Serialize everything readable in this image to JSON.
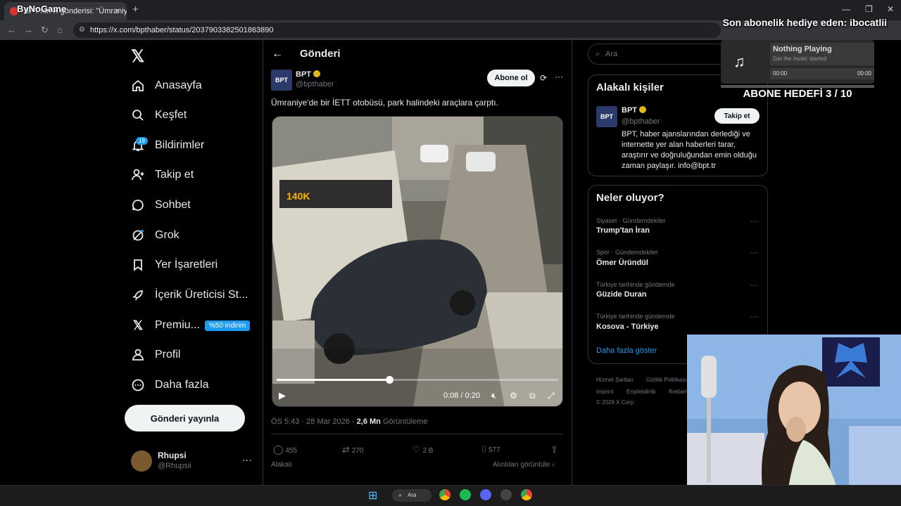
{
  "browser": {
    "tab_title": "BPT'nin X gönderisi: \"Ümraniye'de bir",
    "tab_close": "×",
    "new_tab": "+",
    "url": "https://x.com/bpthaber/status/2037903382501863890"
  },
  "overlays": {
    "logo_text": "ByNoGame",
    "subscriber_gift": "Son abonelik hediye eden: ibocatlii",
    "music_title": "Nothing Playing",
    "music_subtitle": "Get the music started",
    "music_time_start": "00:00",
    "music_time_end": "00:00",
    "abone_goal": "ABONE HEDEFİ 3 / 10"
  },
  "nav": {
    "items": [
      {
        "label": "Anasayfa",
        "icon": "home-icon"
      },
      {
        "label": "Keşfet",
        "icon": "search-icon"
      },
      {
        "label": "Bildirimler",
        "icon": "bell-icon"
      },
      {
        "label": "Takip et",
        "icon": "follow-icon"
      },
      {
        "label": "Sohbet",
        "icon": "chat-icon"
      },
      {
        "label": "Grok",
        "icon": "grok-icon"
      },
      {
        "label": "Yer İşaretleri",
        "icon": "bookmark-icon"
      },
      {
        "label": "İçerik Üreticisi St...",
        "icon": "rocket-icon"
      },
      {
        "label": "Premiu...",
        "icon": "x-icon"
      },
      {
        "label": "Profil",
        "icon": "profile-icon"
      },
      {
        "label": "Daha fazla",
        "icon": "more-icon"
      }
    ],
    "notification_count": "19",
    "premium_badge": "%50 indirim",
    "post_button": "Gönderi yayınla"
  },
  "account": {
    "name": "Rhupsi",
    "handle": "@Rhupsii",
    "more": "···"
  },
  "post": {
    "header": "Gönderi",
    "author_avatar_text": "BPT",
    "author_name": "BPT",
    "author_handle": "@bpthaber",
    "follow_label": "Abone ol",
    "more": "···",
    "text": "Ümraniye'de bir İETT otobüsü, park halindeki araçlara çarptı.",
    "video_time": "0:08 / 0:20",
    "video_progress": 0.4,
    "timestamp": "ÖS 5:43 · 28 Mar 2026 · ",
    "views_count": "2,6 Mn",
    "views_label": " Görüntüleme",
    "stats": {
      "replies": "455",
      "reposts": "270",
      "likes": "2 B",
      "bookmarks": "577"
    },
    "related": "Alakalı",
    "quotes": "Alıntıları görüntüle ›"
  },
  "right": {
    "search_placeholder": "Ara",
    "people_title": "Alakalı kişiler",
    "person": {
      "avatar_text": "BPT",
      "name": "BPT",
      "handle": "@bpthaber",
      "follow": "Takip et",
      "bio": "BPT, haber ajanslarından derlediği ve internette yer alan haberleri tarar, araştırır ve doğruluğundan emin olduğu zaman paylaşır. info@bpt.tr"
    },
    "trends_title": "Neler oluyor?",
    "trends": [
      {
        "category": "Siyaset · Gündemdekiler",
        "name": "Trump'tan İran"
      },
      {
        "category": "Spor · Gündemdekiler",
        "name": "Ömer Üründül"
      },
      {
        "category": "Türkiye tarihinde gündemde",
        "name": "Güzide Duran"
      },
      {
        "category": "Türkiye tarihinde gündemde",
        "name": "Kosova - Türkiye"
      }
    ],
    "show_more": "Daha fazla göster",
    "footer": {
      "terms": "Hizmet Şartları",
      "privacy": "Gizlilik Politikası",
      "imprint": "Imprint",
      "accessibility": "Erişilebilirlik",
      "ads": "Reklam",
      "copyright": "© 2026 X Corp."
    }
  },
  "taskbar": {
    "search_label": "Ara"
  }
}
